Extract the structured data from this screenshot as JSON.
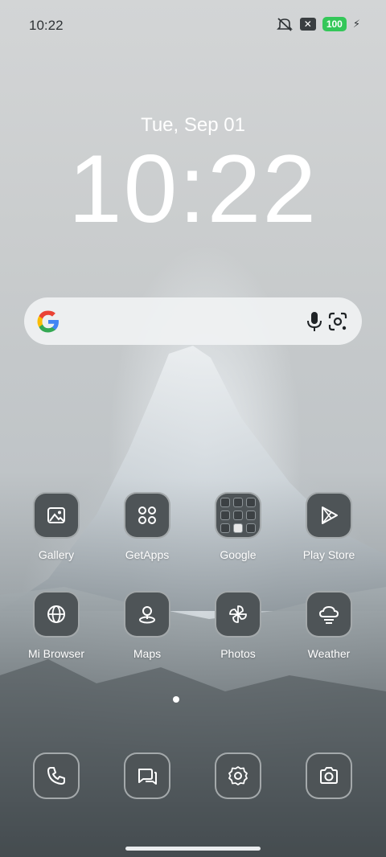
{
  "status_bar": {
    "time": "10:22",
    "battery": "100",
    "icons": [
      "mute-icon",
      "close-box-icon",
      "battery-icon",
      "charging-icon"
    ]
  },
  "lock": {
    "date": "Tue, Sep 01",
    "time": "10:22"
  },
  "search": {
    "icons": [
      "google-logo",
      "microphone-icon",
      "lens-icon"
    ]
  },
  "apps": [
    {
      "label": "Gallery",
      "icon": "gallery-icon"
    },
    {
      "label": "GetApps",
      "icon": "getapps-icon"
    },
    {
      "label": "Google",
      "icon": "folder-icon"
    },
    {
      "label": "Play Store",
      "icon": "play-store-icon"
    },
    {
      "label": "Mi Browser",
      "icon": "browser-icon"
    },
    {
      "label": "Maps",
      "icon": "maps-icon"
    },
    {
      "label": "Photos",
      "icon": "photos-icon"
    },
    {
      "label": "Weather",
      "icon": "weather-icon"
    }
  ],
  "dock": [
    "phone-icon",
    "messages-icon",
    "settings-icon",
    "camera-icon"
  ],
  "colors": {
    "battery": "#34c759",
    "tile": "#4e5457"
  }
}
